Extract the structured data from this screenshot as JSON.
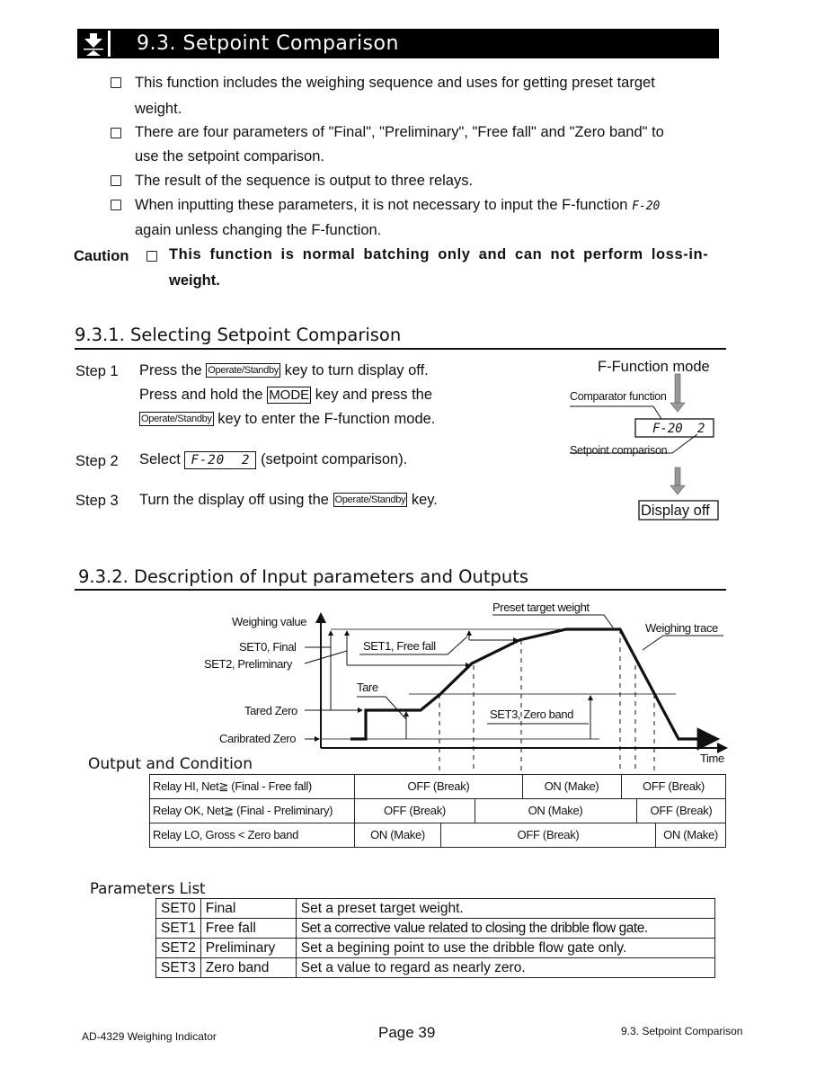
{
  "header": {
    "section_title": "9.3.  Setpoint Comparison",
    "icon": "down-arrow-to-line-icon"
  },
  "intro": {
    "bullets": [
      {
        "line1": "This function includes the weighing sequence and uses for getting preset target",
        "line2": "weight."
      },
      {
        "line1": "There are four parameters of \"Final\", \"Preliminary\", \"Free fall\" and \"Zero band\" to",
        "line2": "use the setpoint comparison."
      },
      {
        "line1": "The result of the sequence is output to three relays.",
        "line2": ""
      },
      {
        "line1": "When inputting these parameters, it is not necessary to input the F-function",
        "line1_lcd": "F-20",
        "line2": "again unless changing the F-function."
      }
    ],
    "caution_label": "Caution",
    "caution_line1": "This function is normal batching only and can not perform loss-in-",
    "caution_line2": "weight."
  },
  "section1": {
    "heading": "9.3.1.  Selecting Setpoint Comparison",
    "steps": [
      {
        "label": "Step 1",
        "l1_pre": "Press the",
        "l1_key": "Operate/Standby",
        "l1_post": "key to turn display off.",
        "l2_pre": "Press and hold the",
        "l2_key": "MODE",
        "l2_post": "key and press the",
        "l3_key": "Operate/Standby",
        "l3_post": "key to enter the F-function mode."
      },
      {
        "label": "Step 2",
        "pre": "Select",
        "lcd": "F-20  2",
        "post": "(setpoint comparison)."
      },
      {
        "label": "Step 3",
        "pre": "Turn the display off using the",
        "key": "Operate/Standby",
        "post": "key."
      }
    ],
    "flow": {
      "title": "F-Function mode",
      "comparator_label": "Comparator function",
      "lcd_left": "F-20",
      "lcd_right": "2",
      "setpoint_label": "Setpoint comparison",
      "result": "Display off"
    }
  },
  "section2": {
    "heading": "9.3.2.  Description of Input parameters and Outputs",
    "diagram": {
      "y_axis_label": "Weighing value",
      "x_axis_label": "Time",
      "preset_label": "Preset target weight",
      "trace_label": "Weighing trace",
      "set0_label": "SET0, Final",
      "set2_label": "SET2, Preliminary",
      "set1_label": "SET1, Free fall",
      "tare_label": "Tare",
      "set3_label": "SET3, Zero band",
      "tared_zero_label": "Tared Zero",
      "calibrated_zero_label": "Caribrated Zero"
    },
    "output_heading": "Output and Condition",
    "relays": [
      {
        "label": "Relay HI,  Net≧ (Final - Free fall)",
        "segments": [
          "OFF (Break)",
          "ON (Make)",
          "OFF (Break)"
        ]
      },
      {
        "label": "Relay OK, Net≧ (Final - Preliminary)",
        "segments": [
          "OFF (Break)",
          "ON (Make)",
          "OFF (Break)"
        ]
      },
      {
        "label": "Relay LO, Gross < Zero band",
        "segments": [
          "ON (Make)",
          "OFF (Break)",
          "ON (Make)"
        ]
      }
    ],
    "params_heading": "Parameters List",
    "params": [
      {
        "code": "SET0",
        "name": "Final",
        "desc": "Set a preset target weight."
      },
      {
        "code": "SET1",
        "name": "Free fall",
        "desc": "Set a corrective value related to closing the dribble flow gate."
      },
      {
        "code": "SET2",
        "name": "Preliminary",
        "desc": "Set a begining point to use the dribble flow gate only."
      },
      {
        "code": "SET3",
        "name": "Zero band",
        "desc": "Set a value to regard as nearly zero."
      }
    ]
  },
  "footer": {
    "left": "AD-4329 Weighing Indicator",
    "center": "Page 39",
    "right": "9.3. Setpoint Comparison"
  }
}
